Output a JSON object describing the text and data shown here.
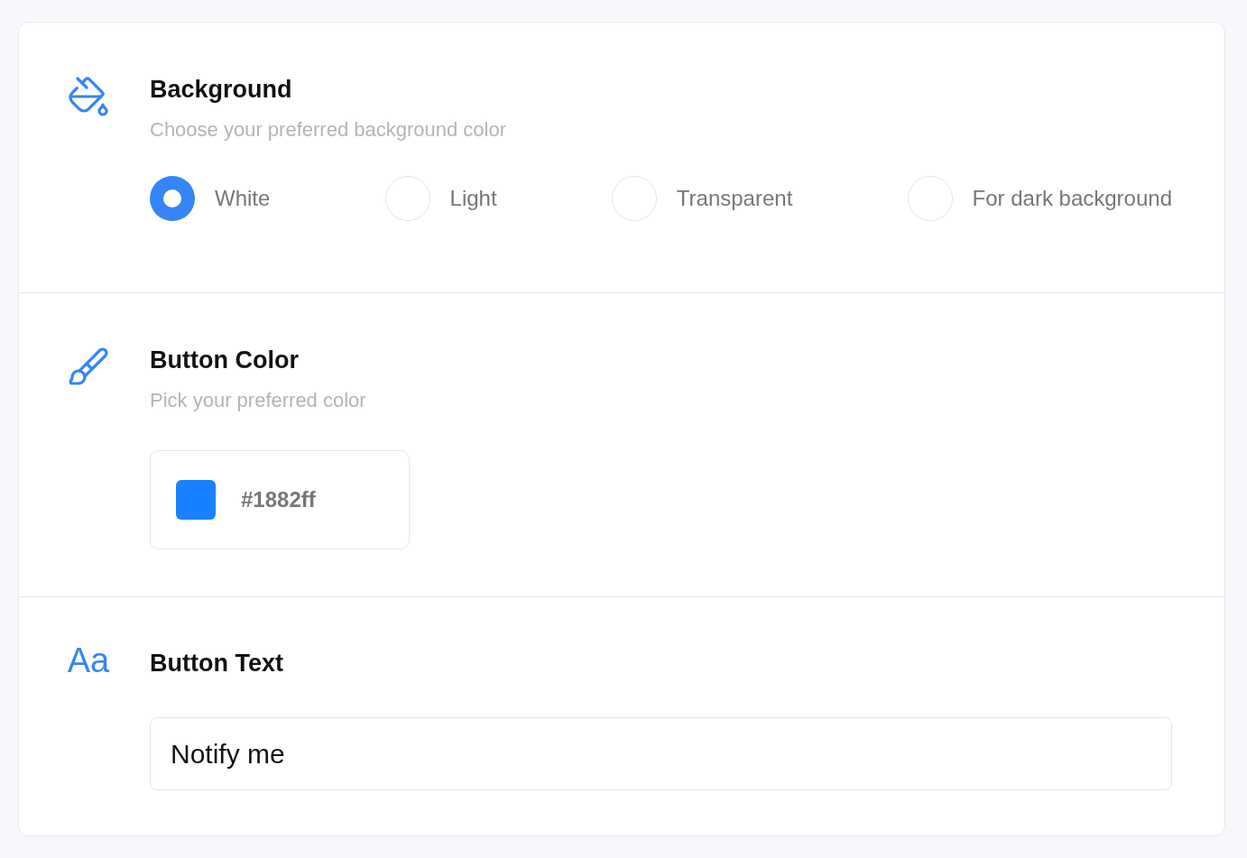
{
  "background": {
    "title": "Background",
    "subtitle": "Choose your preferred background color",
    "options": [
      {
        "label": "White",
        "selected": true
      },
      {
        "label": "Light",
        "selected": false
      },
      {
        "label": "Transparent",
        "selected": false
      },
      {
        "label": "For dark background",
        "selected": false
      }
    ]
  },
  "button_color": {
    "title": "Button Color",
    "subtitle": "Pick your preferred color",
    "value": "#1882ff",
    "color": "#1882ff"
  },
  "button_text": {
    "icon_text": "Aa",
    "title": "Button Text",
    "value": "Notify me"
  }
}
